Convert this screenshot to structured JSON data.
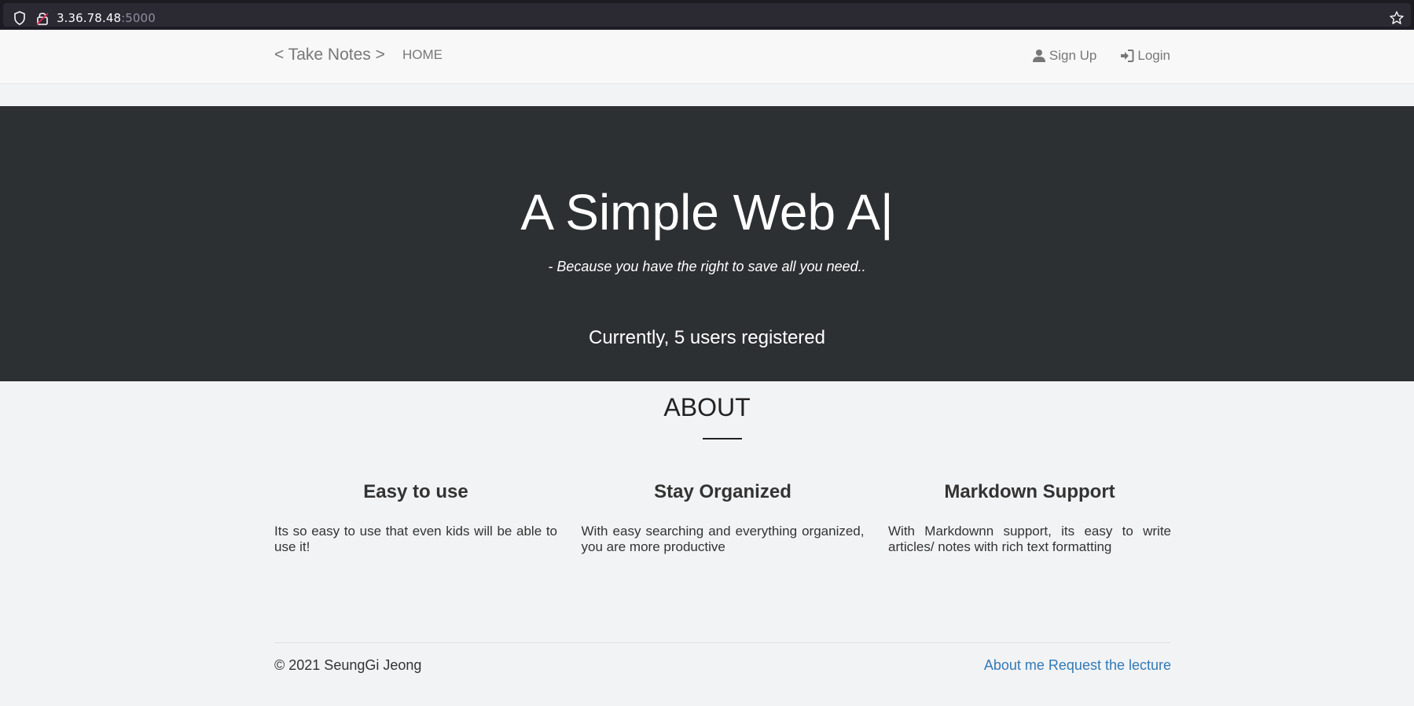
{
  "browser": {
    "url_host": "3.36.78.48",
    "url_port": ":5000"
  },
  "navbar": {
    "brand": "< Take Notes >",
    "home": "HOME",
    "signup": "Sign Up",
    "login": "Login"
  },
  "hero": {
    "title": "A Simple Web A",
    "cursor": "|",
    "tagline": "- Because you have the right to save all you need..",
    "users_text": "Currently, 5 users registered"
  },
  "about": {
    "title": "ABOUT",
    "features": [
      {
        "title": "Easy to use",
        "text": "Its so easy to use that even kids will be able to use it!"
      },
      {
        "title": "Stay Organized",
        "text": "With easy searching and everything organized, you are more productive"
      },
      {
        "title": "Markdown Support",
        "text": "With Markdownn support, its easy to write articles/ notes with rich text formatting"
      }
    ]
  },
  "footer": {
    "copyright": "© 2021 SeungGi Jeong",
    "about_me": "About me",
    "request": "Request the lecture"
  },
  "icons": {
    "shield": "shield-icon",
    "lock": "lock-icon",
    "star": "star-icon",
    "user": "user-icon",
    "login": "login-icon"
  },
  "colors": {
    "hero_bg": "#2d3033",
    "link": "#337ab7",
    "nav_text": "#777777"
  }
}
